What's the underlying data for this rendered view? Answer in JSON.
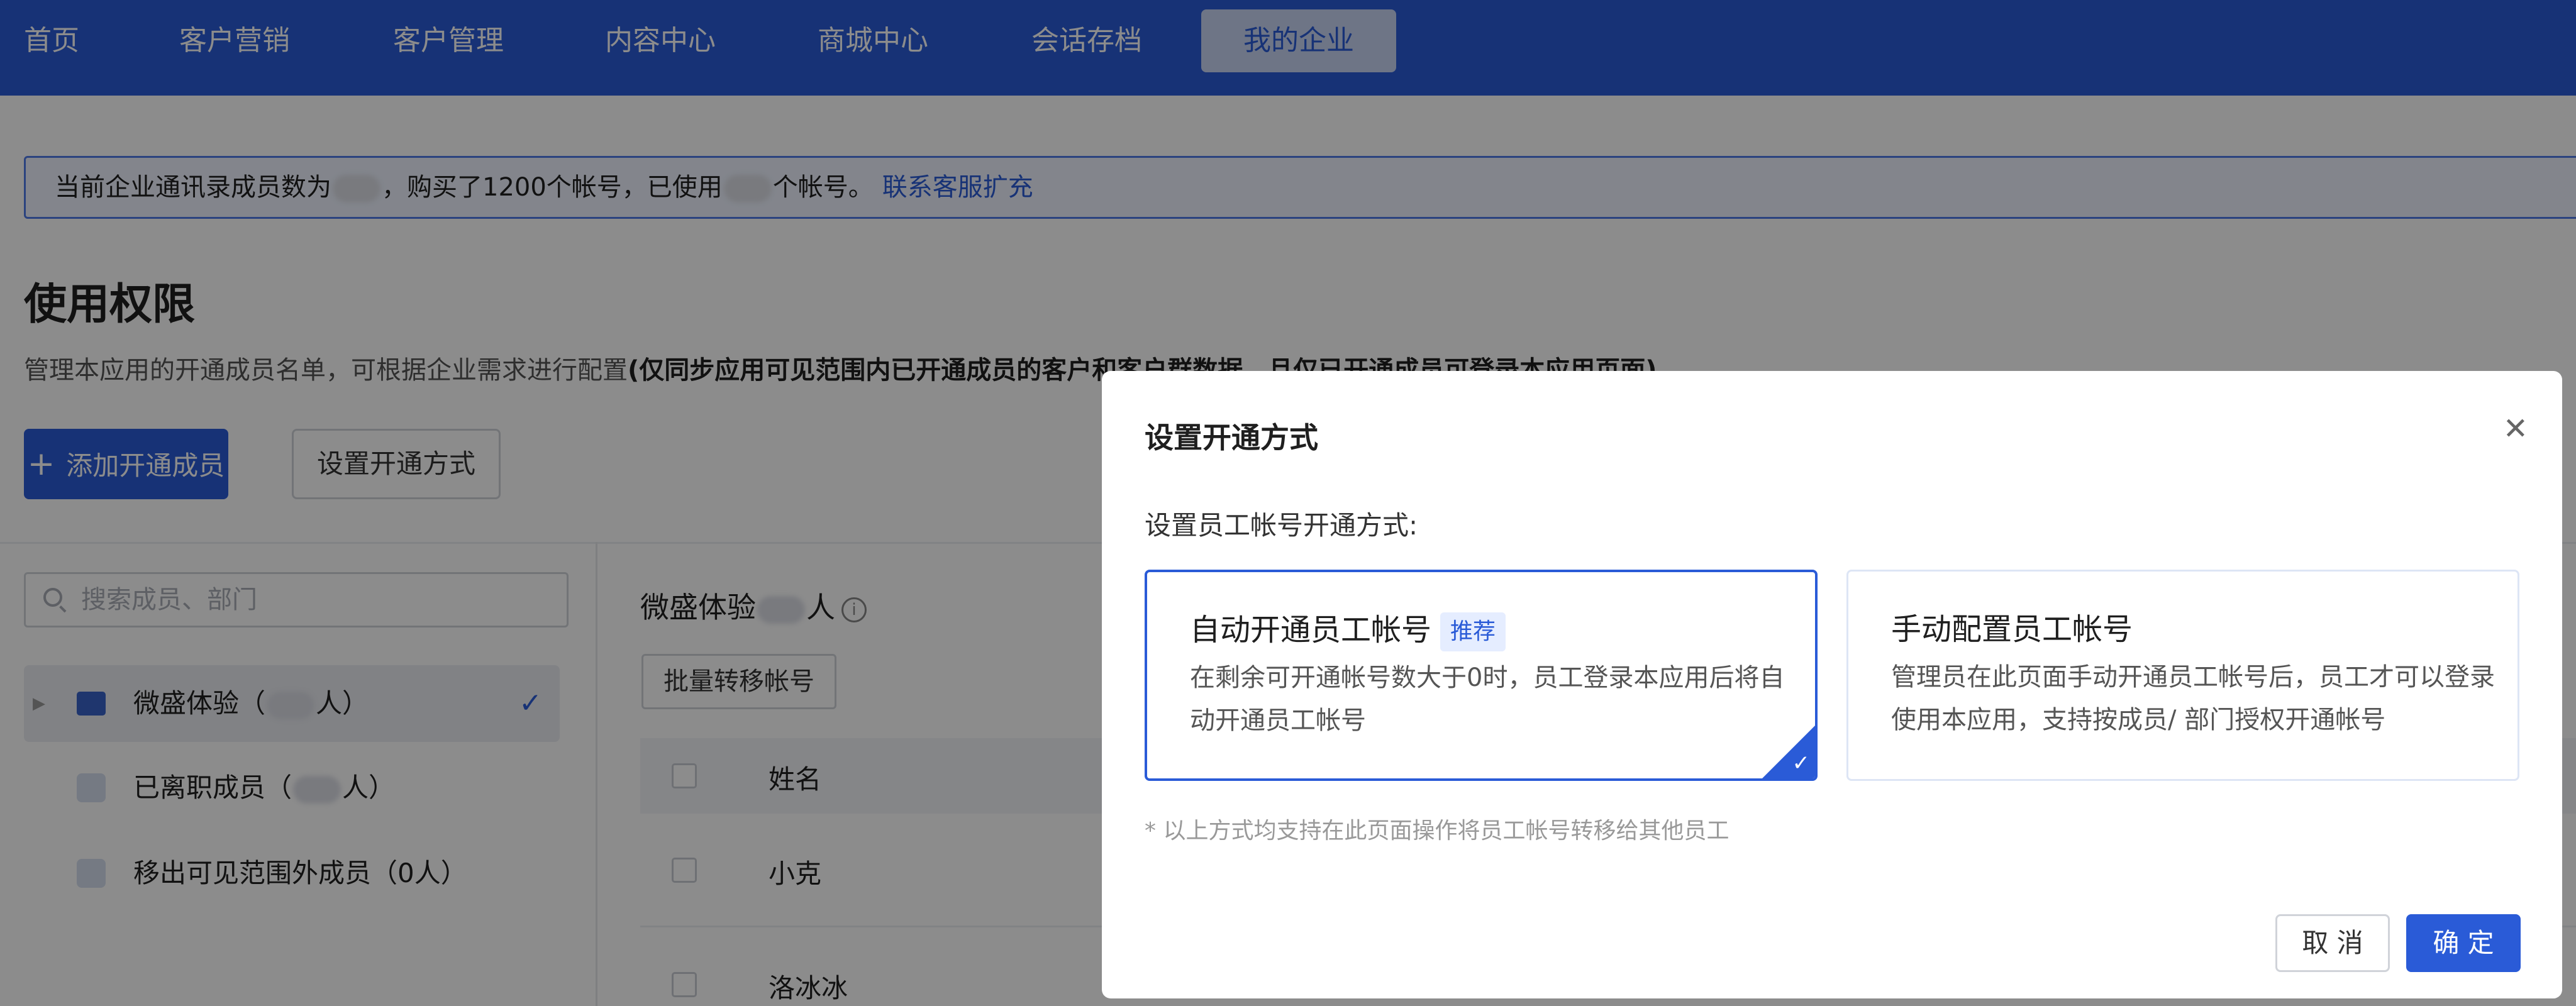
{
  "nav": {
    "items": [
      "首页",
      "客户营销",
      "客户管理",
      "内容中心",
      "商城中心",
      "会话存档",
      "我的企业"
    ],
    "active_index": 6
  },
  "notice": {
    "text_part1": "当前企业通讯录成员数为",
    "text_part2": "，购买了1200个帐号，已使用",
    "text_part3": "个帐号。",
    "link": "联系客服扩充"
  },
  "page": {
    "title": "使用权限",
    "desc_normal": "管理本应用的开通成员名单，可根据企业需求进行配置",
    "desc_bold": "(仅同步应用可见范围内已开通成员的客户和客户群数据，且仅已开通成员可登录本应用页面)",
    "add_button": "添加开通成员",
    "setup_button": "设置开通方式"
  },
  "sidebar": {
    "search_placeholder": "搜索成员、部门",
    "tree": [
      {
        "label_a": "微盛体验（",
        "label_b": "人）",
        "selected": true
      },
      {
        "label_a": "已离职成员（",
        "label_b": "人）",
        "selected": false
      },
      {
        "label_a": "移出可见范围外成员（0人）",
        "label_b": "",
        "selected": false
      }
    ]
  },
  "main": {
    "title_a": "微盛体验",
    "title_b": "人",
    "batch_button": "批量转移帐号",
    "table_headers": [
      "姓名"
    ],
    "rows": [
      "小克",
      "洛冰冰"
    ]
  },
  "modal": {
    "title": "设置开通方式",
    "subtitle": "设置员工帐号开通方式:",
    "options": [
      {
        "title": "自动开通员工帐号",
        "badge": "推荐",
        "desc": "在剩余可开通帐号数大于0时，员工登录本应用后将自动开通员工帐号",
        "selected": true
      },
      {
        "title": "手动配置员工帐号",
        "badge": "",
        "desc": "管理员在此页面手动开通员工帐号后，员工才可以登录使用本应用，支持按成员/ 部门授权开通帐号",
        "selected": false
      }
    ],
    "note": "* 以上方式均支持在此页面操作将员工帐号转移给其他员工",
    "cancel": "取 消",
    "confirm": "确 定"
  },
  "colors": {
    "brand": "#2a5bd7",
    "mask": "rgba(0,0,0,0.45)"
  },
  "icons": [
    "search-icon",
    "folder-icon",
    "user-icon",
    "check-icon",
    "info-icon",
    "close-icon",
    "plus-icon",
    "chevron-right-icon"
  ]
}
